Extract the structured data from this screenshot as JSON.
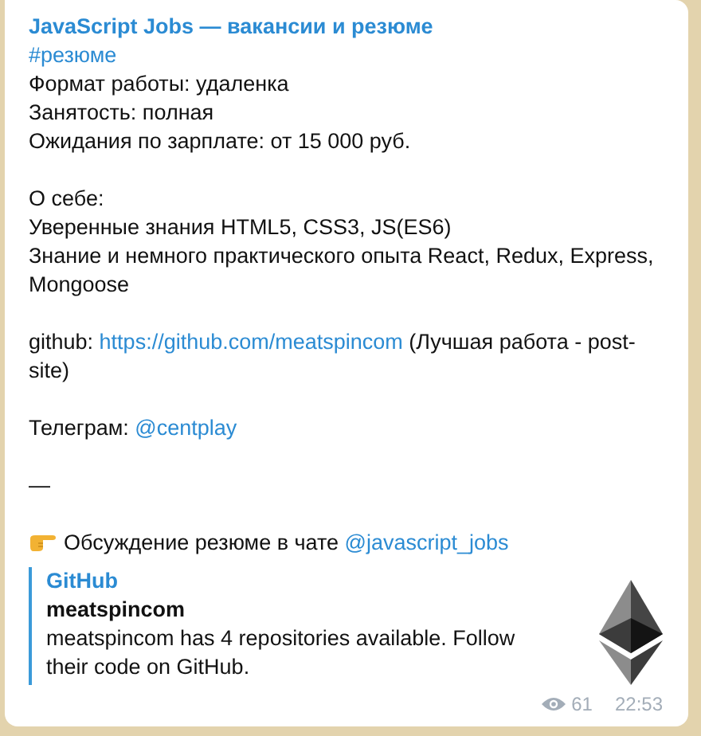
{
  "message": {
    "channel": "JavaScript Jobs — вакансии и резюме",
    "paragraphs": [
      {
        "lines": [
          [
            {
              "kind": "link",
              "text": "#резюме"
            }
          ],
          [
            {
              "kind": "text",
              "text": "Формат работы: удаленка"
            }
          ],
          [
            {
              "kind": "text",
              "text": "Занятость: полная"
            }
          ],
          [
            {
              "kind": "text",
              "text": "Ожидания по зарплате: от 15 000 руб."
            }
          ]
        ]
      },
      {
        "lines": [
          [
            {
              "kind": "text",
              "text": "О себе:"
            }
          ],
          [
            {
              "kind": "text",
              "text": "Уверенные знания HTML5, CSS3, JS(ES6)"
            }
          ],
          [
            {
              "kind": "text",
              "text": "Знание и немного практического опыта React, Redux, Express, Mongoose"
            }
          ]
        ]
      },
      {
        "lines": [
          [
            {
              "kind": "text",
              "text": "github: "
            },
            {
              "kind": "link",
              "text": "https://github.com/meatspincom"
            },
            {
              "kind": "text",
              "text": " (Лучшая работа - post-site)"
            }
          ]
        ]
      },
      {
        "lines": [
          [
            {
              "kind": "text",
              "text": "Телеграм: "
            },
            {
              "kind": "link",
              "text": "@centplay"
            }
          ]
        ]
      },
      {
        "lines": [
          [
            {
              "kind": "text",
              "text": "—"
            }
          ]
        ]
      },
      {
        "lines": [
          [
            {
              "kind": "emoji"
            },
            {
              "kind": "text",
              "text": "Обсуждение резюме в чате "
            },
            {
              "kind": "link",
              "text": "@javascript_jobs"
            }
          ]
        ]
      }
    ],
    "preview": {
      "site": "GitHub",
      "title": "meatspincom",
      "description": "meatspincom has 4 repositories available. Follow their code on GitHub."
    },
    "views": "61",
    "time": "22:53"
  }
}
